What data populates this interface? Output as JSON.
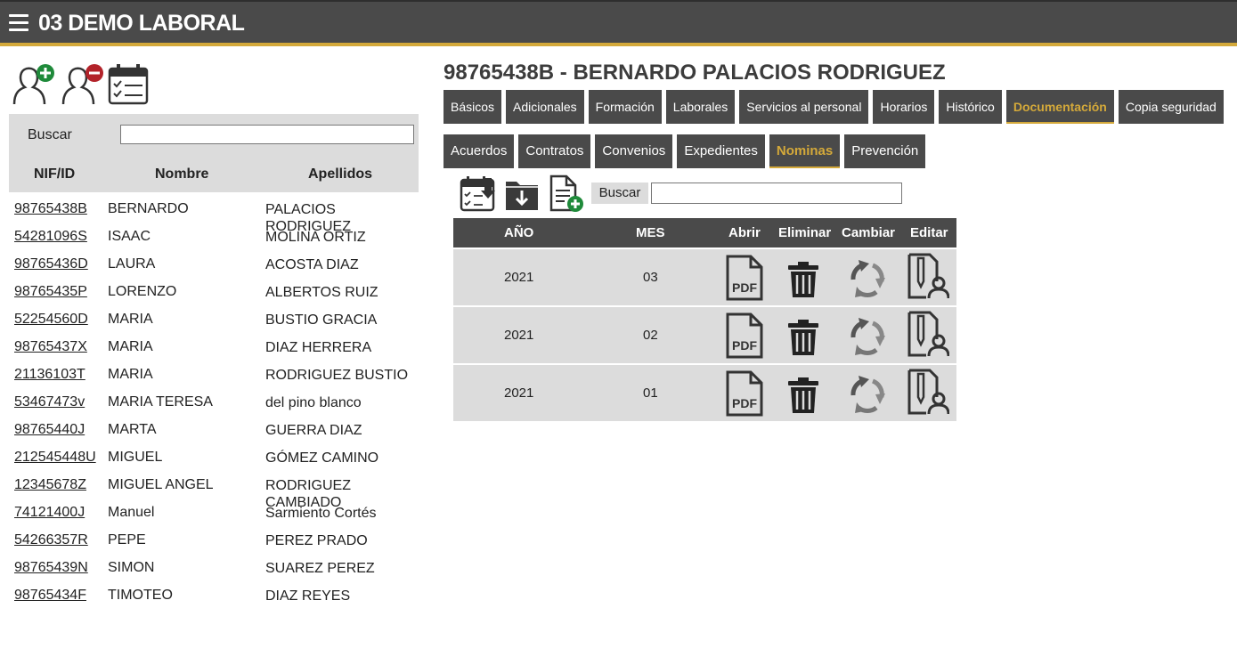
{
  "app": {
    "title": "03 DEMO LABORAL"
  },
  "left": {
    "toolbar": {
      "add_employee_icon": "user-add-icon",
      "remove_employee_icon": "user-remove-icon",
      "calendar_icon": "calendar-check-icon"
    },
    "search": {
      "label": "Buscar",
      "value": "",
      "placeholder": ""
    },
    "columns": {
      "nif": "NIF/ID",
      "nombre": "Nombre",
      "apellidos": "Apellidos"
    },
    "employees": [
      {
        "nif": "98765438B",
        "nombre": "BERNARDO",
        "apellidos": "PALACIOS RODRIGUEZ"
      },
      {
        "nif": "54281096S",
        "nombre": "ISAAC",
        "apellidos": "MOLINA ORTIZ"
      },
      {
        "nif": "98765436D",
        "nombre": "LAURA",
        "apellidos": "ACOSTA DIAZ"
      },
      {
        "nif": "98765435P",
        "nombre": "LORENZO",
        "apellidos": "ALBERTOS RUIZ"
      },
      {
        "nif": "52254560D",
        "nombre": "MARIA",
        "apellidos": "BUSTIO GRACIA"
      },
      {
        "nif": "98765437X",
        "nombre": "MARIA",
        "apellidos": "DIAZ HERRERA"
      },
      {
        "nif": "21136103T",
        "nombre": "MARIA",
        "apellidos": "RODRIGUEZ BUSTIO"
      },
      {
        "nif": "53467473v",
        "nombre": "MARIA TERESA",
        "apellidos": "del pino blanco"
      },
      {
        "nif": "98765440J",
        "nombre": "MARTA",
        "apellidos": "GUERRA DIAZ"
      },
      {
        "nif": "212545448U",
        "nombre": "MIGUEL",
        "apellidos": "GÓMEZ CAMINO"
      },
      {
        "nif": "12345678Z",
        "nombre": "MIGUEL ANGEL",
        "apellidos": "RODRIGUEZ CAMBIADO"
      },
      {
        "nif": "74121400J",
        "nombre": "Manuel",
        "apellidos": "Sarmiento Cortés"
      },
      {
        "nif": "54266357R",
        "nombre": "PEPE",
        "apellidos": "PEREZ PRADO"
      },
      {
        "nif": "98765439N",
        "nombre": "SIMON",
        "apellidos": "SUAREZ PEREZ"
      },
      {
        "nif": "98765434F",
        "nombre": "TIMOTEO",
        "apellidos": "DIAZ REYES"
      }
    ]
  },
  "right": {
    "employee_title": "98765438B - BERNARDO PALACIOS RODRIGUEZ",
    "tabs": [
      {
        "label": "Básicos",
        "active": false
      },
      {
        "label": "Adicionales",
        "active": false
      },
      {
        "label": "Formación",
        "active": false
      },
      {
        "label": "Laborales",
        "active": false
      },
      {
        "label": "Servicios al personal",
        "active": false
      },
      {
        "label": "Horarios",
        "active": false
      },
      {
        "label": "Histórico",
        "active": false
      },
      {
        "label": "Documentación",
        "active": true
      },
      {
        "label": "Copia seguridad",
        "active": false
      }
    ],
    "sub_tabs": [
      {
        "label": "Acuerdos",
        "active": false
      },
      {
        "label": "Contratos",
        "active": false
      },
      {
        "label": "Convenios",
        "active": false
      },
      {
        "label": "Expedientes",
        "active": false
      },
      {
        "label": "Nominas",
        "active": true
      },
      {
        "label": "Prevención",
        "active": false
      }
    ],
    "toolbar": {
      "search_label": "Buscar",
      "search_value": "",
      "icons": [
        "calendar-download-icon",
        "folder-download-icon",
        "document-add-icon"
      ]
    },
    "table": {
      "headers": {
        "year": "AÑO",
        "month": "MES",
        "open": "Abrir",
        "delete": "Eliminar",
        "change": "Cambiar",
        "edit": "Editar"
      },
      "rows": [
        {
          "year": "2021",
          "month": "03"
        },
        {
          "year": "2021",
          "month": "02"
        },
        {
          "year": "2021",
          "month": "01"
        }
      ]
    }
  },
  "colors": {
    "topbar": "#4a4a4a",
    "accent": "#d4a93a",
    "panel": "#dcdcdc",
    "add": "#1f8a3a",
    "remove": "#b3232a"
  }
}
